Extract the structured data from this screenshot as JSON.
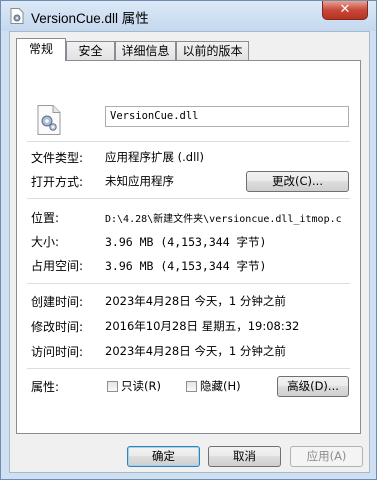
{
  "window": {
    "title": "VersionCue.dll 属性",
    "close_label": "✕"
  },
  "tabs": [
    {
      "label": "常规"
    },
    {
      "label": "安全"
    },
    {
      "label": "详细信息"
    },
    {
      "label": "以前的版本"
    }
  ],
  "general": {
    "file_name": "VersionCue.dll",
    "file_type_label": "文件类型:",
    "file_type_value": "应用程序扩展 (.dll)",
    "open_with_label": "打开方式:",
    "open_with_value": "未知应用程序",
    "change_button": "更改(C)...",
    "location_label": "位置:",
    "location_value": "D:\\4.28\\新建文件夹\\versioncue.dll_itmop.c",
    "size_label": "大小:",
    "size_value": "3.96 MB (4,153,344 字节)",
    "size_on_disk_label": "占用空间:",
    "size_on_disk_value": "3.96 MB (4,153,344 字节)",
    "created_label": "创建时间:",
    "created_value": "2023年4月28日 今天，1 分钟之前",
    "modified_label": "修改时间:",
    "modified_value": "2016年10月28日 星期五，19:08:32",
    "accessed_label": "访问时间:",
    "accessed_value": "2023年4月28日 今天，1 分钟之前",
    "attributes_label": "属性:",
    "readonly_label": "只读(R)",
    "hidden_label": "隐藏(H)",
    "advanced_button": "高级(D)..."
  },
  "footer": {
    "ok_button": "确定",
    "cancel_button": "取消",
    "apply_button": "应用(A)"
  }
}
